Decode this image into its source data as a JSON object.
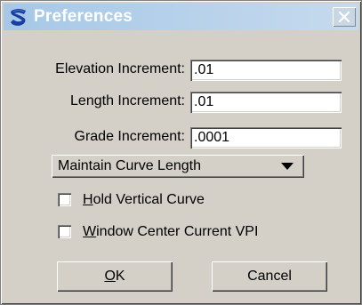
{
  "window": {
    "title": "Preferences"
  },
  "fields": [
    {
      "label": "Elevation Increment:",
      "value": ".01"
    },
    {
      "label": "Length Increment:",
      "value": ".01"
    },
    {
      "label": "Grade Increment:",
      "value": ".0001"
    }
  ],
  "dropdown": {
    "selected": "Maintain Curve Length"
  },
  "checkboxes": [
    {
      "mnemonic": "H",
      "rest": "old Vertical Curve",
      "checked": false
    },
    {
      "mnemonic": "W",
      "rest": "indow Center Current VPI",
      "checked": false
    }
  ],
  "buttons": {
    "ok": {
      "mnemonic": "O",
      "rest": "K"
    },
    "cancel": "Cancel"
  },
  "colors": {
    "titlebar_start": "#a6c8e6",
    "titlebar_end": "#c6daee",
    "dialog_face": "#d4d0c8",
    "app_icon": "#1a3e9e"
  },
  "icons": {
    "app": "app-logo-icon",
    "close": "close-icon",
    "dropdown": "dropdown-arrow-icon"
  }
}
